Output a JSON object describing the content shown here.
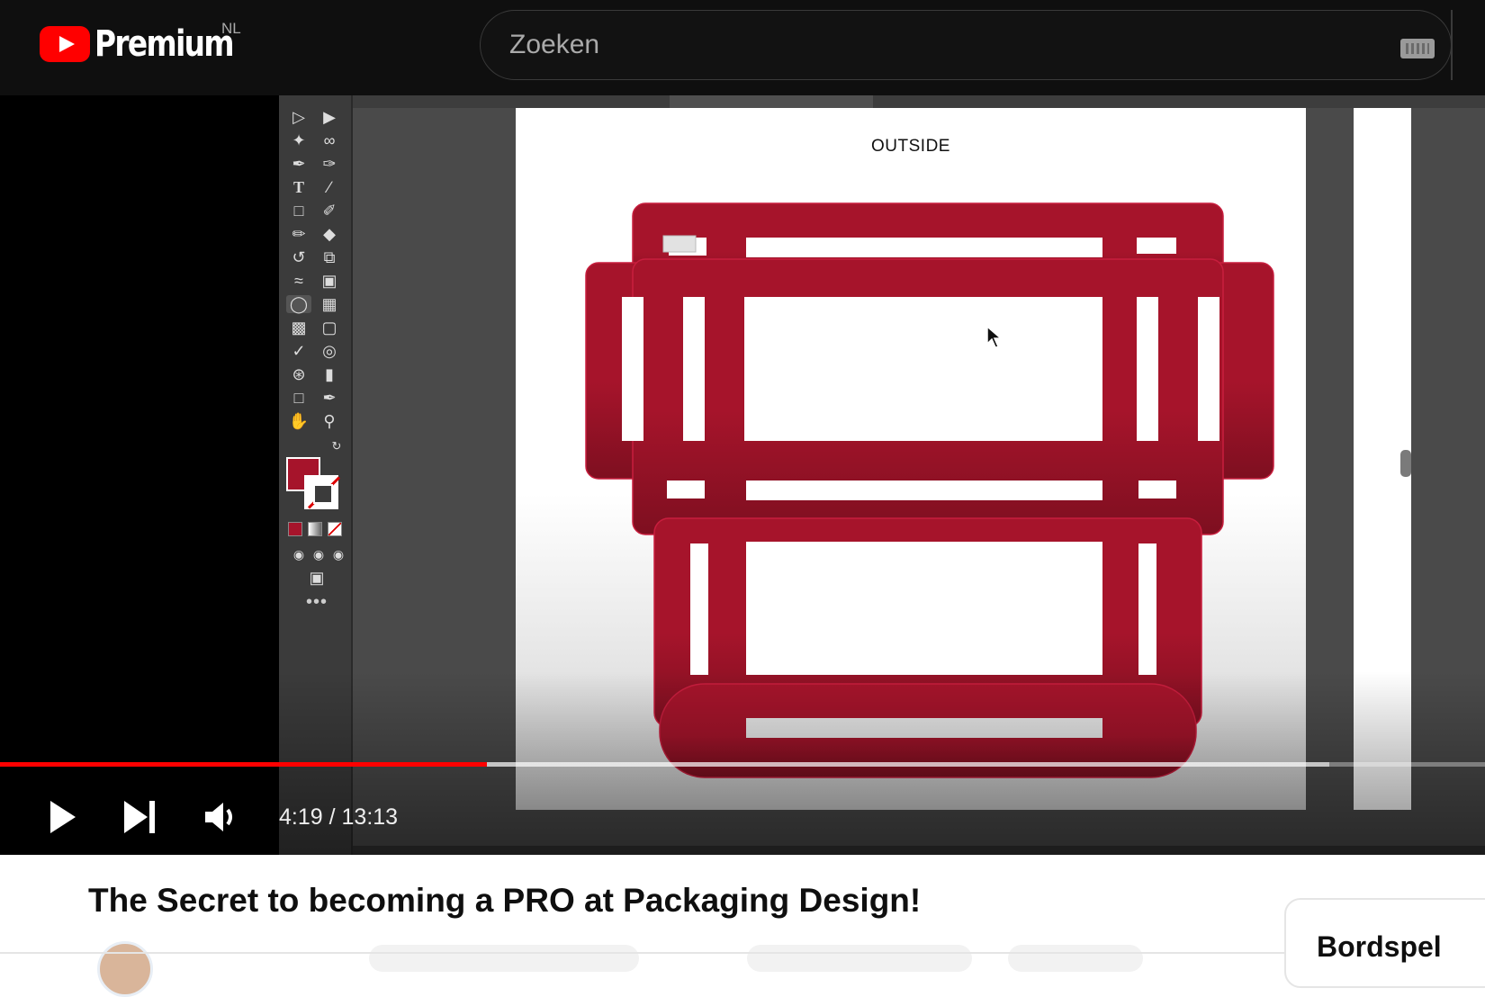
{
  "header": {
    "brand": "Premium",
    "country": "NL",
    "search_placeholder": "Zoeken"
  },
  "artboard": {
    "label": "OUTSIDE",
    "fill_color": "#a6142b"
  },
  "player": {
    "current_time": "4:19",
    "separator": " / ",
    "duration": "13:13",
    "progress_fraction": 0.328,
    "buffer_fraction": 0.895,
    "accent": "#ff0000"
  },
  "video": {
    "title": "The Secret to becoming a PRO at Packaging Design!"
  },
  "sidebar": {
    "card_title": "Bordspel"
  }
}
